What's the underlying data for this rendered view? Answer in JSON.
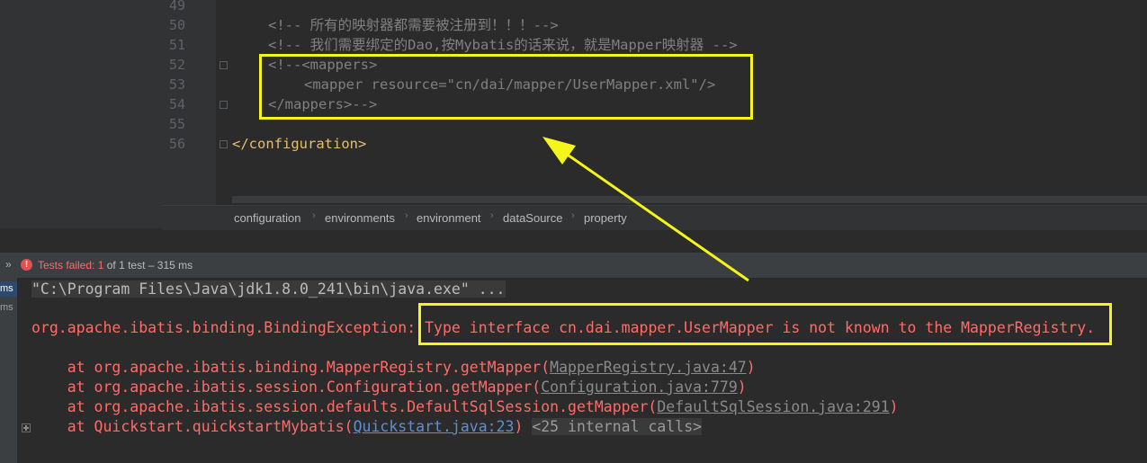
{
  "editor": {
    "line_numbers": [
      "49",
      "50",
      "51",
      "52",
      "53",
      "54",
      "55",
      "56"
    ],
    "lines": {
      "l50": "<!-- 所有的映射器都需要被注册到！！！-->",
      "l51": "<!-- 我们需要绑定的Dao,按Mybatis的话来说，就是Mapper映射器 -->",
      "l52": "<!--<mappers>",
      "l53_tag_open": "<mapper",
      "l53_attr": " resource=",
      "l53_value": "\"cn/dai/mapper/UserMapper.xml\"",
      "l53_tag_close": "/>",
      "l54": "</mappers>-->",
      "l56": "</configuration>"
    }
  },
  "breadcrumb": [
    "configuration",
    "environments",
    "environment",
    "dataSource",
    "property"
  ],
  "test_bar": {
    "label": "Tests failed:",
    "count": "1",
    "rest": "of 1 test – 315 ms"
  },
  "console": {
    "ms_labels": [
      "ms",
      "ms"
    ],
    "command": "\"C:\\Program Files\\Java\\jdk1.8.0_241\\bin\\java.exe\" ...",
    "exception_class": "org.apache.ibatis.binding.BindingException:",
    "exception_message": "Type interface cn.dai.mapper.UserMapper is not known to the MapperRegistry.",
    "stack": [
      {
        "prefix": "    at org.apache.ibatis.binding.MapperRegistry.getMapper(",
        "link": "MapperRegistry.java:47",
        "suffix": ")"
      },
      {
        "prefix": "    at org.apache.ibatis.session.Configuration.getMapper(",
        "link": "Configuration.java:779",
        "suffix": ")"
      },
      {
        "prefix": "    at org.apache.ibatis.session.defaults.DefaultSqlSession.getMapper(",
        "link": "DefaultSqlSession.java:291",
        "suffix": ")"
      },
      {
        "prefix": "    at Quickstart.quickstartMybatis(",
        "link": "Quickstart.java:23",
        "suffix": ")",
        "internal": "<25 internal calls>"
      }
    ]
  },
  "colors": {
    "highlight": "#f5f51a",
    "error": "#ff6b68",
    "tag": "#e8bf6a",
    "comment": "#808080"
  },
  "icons": [
    "error-circle-icon",
    "chevron-double-right-icon",
    "fold-marker-icon",
    "expand-plus-icon",
    "annotation-arrow"
  ]
}
